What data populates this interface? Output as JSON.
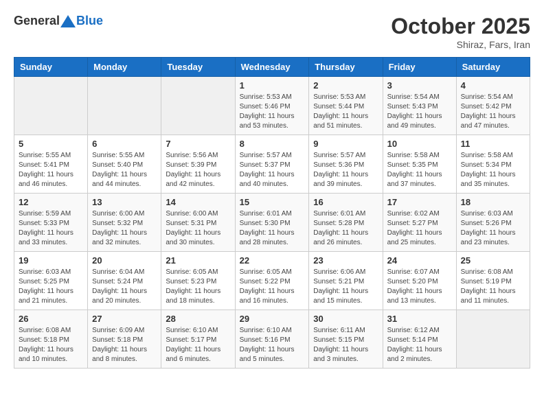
{
  "header": {
    "logo_general": "General",
    "logo_blue": "Blue",
    "month": "October 2025",
    "location": "Shiraz, Fars, Iran"
  },
  "weekdays": [
    "Sunday",
    "Monday",
    "Tuesday",
    "Wednesday",
    "Thursday",
    "Friday",
    "Saturday"
  ],
  "weeks": [
    [
      {
        "day": "",
        "info": ""
      },
      {
        "day": "",
        "info": ""
      },
      {
        "day": "",
        "info": ""
      },
      {
        "day": "1",
        "info": "Sunrise: 5:53 AM\nSunset: 5:46 PM\nDaylight: 11 hours\nand 53 minutes."
      },
      {
        "day": "2",
        "info": "Sunrise: 5:53 AM\nSunset: 5:44 PM\nDaylight: 11 hours\nand 51 minutes."
      },
      {
        "day": "3",
        "info": "Sunrise: 5:54 AM\nSunset: 5:43 PM\nDaylight: 11 hours\nand 49 minutes."
      },
      {
        "day": "4",
        "info": "Sunrise: 5:54 AM\nSunset: 5:42 PM\nDaylight: 11 hours\nand 47 minutes."
      }
    ],
    [
      {
        "day": "5",
        "info": "Sunrise: 5:55 AM\nSunset: 5:41 PM\nDaylight: 11 hours\nand 46 minutes."
      },
      {
        "day": "6",
        "info": "Sunrise: 5:55 AM\nSunset: 5:40 PM\nDaylight: 11 hours\nand 44 minutes."
      },
      {
        "day": "7",
        "info": "Sunrise: 5:56 AM\nSunset: 5:39 PM\nDaylight: 11 hours\nand 42 minutes."
      },
      {
        "day": "8",
        "info": "Sunrise: 5:57 AM\nSunset: 5:37 PM\nDaylight: 11 hours\nand 40 minutes."
      },
      {
        "day": "9",
        "info": "Sunrise: 5:57 AM\nSunset: 5:36 PM\nDaylight: 11 hours\nand 39 minutes."
      },
      {
        "day": "10",
        "info": "Sunrise: 5:58 AM\nSunset: 5:35 PM\nDaylight: 11 hours\nand 37 minutes."
      },
      {
        "day": "11",
        "info": "Sunrise: 5:58 AM\nSunset: 5:34 PM\nDaylight: 11 hours\nand 35 minutes."
      }
    ],
    [
      {
        "day": "12",
        "info": "Sunrise: 5:59 AM\nSunset: 5:33 PM\nDaylight: 11 hours\nand 33 minutes."
      },
      {
        "day": "13",
        "info": "Sunrise: 6:00 AM\nSunset: 5:32 PM\nDaylight: 11 hours\nand 32 minutes."
      },
      {
        "day": "14",
        "info": "Sunrise: 6:00 AM\nSunset: 5:31 PM\nDaylight: 11 hours\nand 30 minutes."
      },
      {
        "day": "15",
        "info": "Sunrise: 6:01 AM\nSunset: 5:30 PM\nDaylight: 11 hours\nand 28 minutes."
      },
      {
        "day": "16",
        "info": "Sunrise: 6:01 AM\nSunset: 5:28 PM\nDaylight: 11 hours\nand 26 minutes."
      },
      {
        "day": "17",
        "info": "Sunrise: 6:02 AM\nSunset: 5:27 PM\nDaylight: 11 hours\nand 25 minutes."
      },
      {
        "day": "18",
        "info": "Sunrise: 6:03 AM\nSunset: 5:26 PM\nDaylight: 11 hours\nand 23 minutes."
      }
    ],
    [
      {
        "day": "19",
        "info": "Sunrise: 6:03 AM\nSunset: 5:25 PM\nDaylight: 11 hours\nand 21 minutes."
      },
      {
        "day": "20",
        "info": "Sunrise: 6:04 AM\nSunset: 5:24 PM\nDaylight: 11 hours\nand 20 minutes."
      },
      {
        "day": "21",
        "info": "Sunrise: 6:05 AM\nSunset: 5:23 PM\nDaylight: 11 hours\nand 18 minutes."
      },
      {
        "day": "22",
        "info": "Sunrise: 6:05 AM\nSunset: 5:22 PM\nDaylight: 11 hours\nand 16 minutes."
      },
      {
        "day": "23",
        "info": "Sunrise: 6:06 AM\nSunset: 5:21 PM\nDaylight: 11 hours\nand 15 minutes."
      },
      {
        "day": "24",
        "info": "Sunrise: 6:07 AM\nSunset: 5:20 PM\nDaylight: 11 hours\nand 13 minutes."
      },
      {
        "day": "25",
        "info": "Sunrise: 6:08 AM\nSunset: 5:19 PM\nDaylight: 11 hours\nand 11 minutes."
      }
    ],
    [
      {
        "day": "26",
        "info": "Sunrise: 6:08 AM\nSunset: 5:18 PM\nDaylight: 11 hours\nand 10 minutes."
      },
      {
        "day": "27",
        "info": "Sunrise: 6:09 AM\nSunset: 5:18 PM\nDaylight: 11 hours\nand 8 minutes."
      },
      {
        "day": "28",
        "info": "Sunrise: 6:10 AM\nSunset: 5:17 PM\nDaylight: 11 hours\nand 6 minutes."
      },
      {
        "day": "29",
        "info": "Sunrise: 6:10 AM\nSunset: 5:16 PM\nDaylight: 11 hours\nand 5 minutes."
      },
      {
        "day": "30",
        "info": "Sunrise: 6:11 AM\nSunset: 5:15 PM\nDaylight: 11 hours\nand 3 minutes."
      },
      {
        "day": "31",
        "info": "Sunrise: 6:12 AM\nSunset: 5:14 PM\nDaylight: 11 hours\nand 2 minutes."
      },
      {
        "day": "",
        "info": ""
      }
    ]
  ]
}
